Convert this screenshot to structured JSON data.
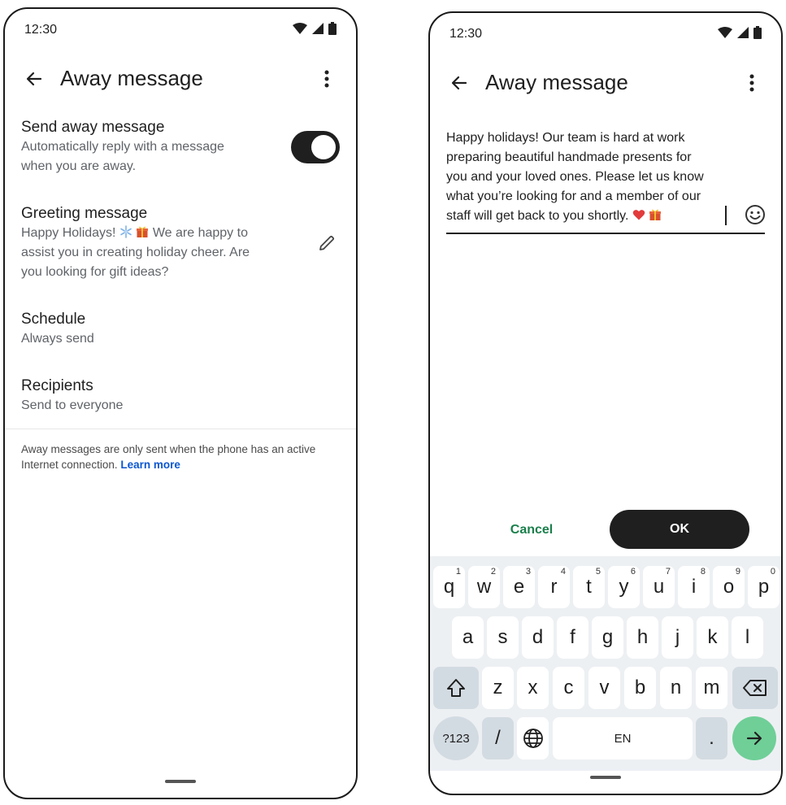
{
  "left": {
    "status_time": "12:30",
    "title": "Away message",
    "send_away": {
      "title": "Send away message",
      "subtitle_line1": "Automatically reply with a message",
      "subtitle_line2": "when you are away.",
      "enabled": true
    },
    "greeting": {
      "title": "Greeting message",
      "line1_a": "Happy Holidays! ",
      "line1_b": " We are happy to",
      "line2": "assist you in creating holiday cheer. Are",
      "line3": "you looking for gift ideas?"
    },
    "schedule": {
      "title": "Schedule",
      "value": "Always send"
    },
    "recipients": {
      "title": "Recipients",
      "value": "Send to everyone"
    },
    "footnote": "Away messages are only sent when the phone has an active Internet connection. ",
    "learn_more": "Learn more"
  },
  "right": {
    "status_time": "12:30",
    "title": "Away message",
    "message_lines": [
      "Happy holidays! Our team is hard at work",
      "preparing beautiful handmade presents for",
      "you and your loved ones. Please let us know",
      "what you’re looking for and a member of our",
      "staff will get back to you shortly. "
    ],
    "cancel_label": "Cancel",
    "ok_label": "OK",
    "keyboard": {
      "row1": [
        {
          "k": "q",
          "h": "1"
        },
        {
          "k": "w",
          "h": "2"
        },
        {
          "k": "e",
          "h": "3"
        },
        {
          "k": "r",
          "h": "4"
        },
        {
          "k": "t",
          "h": "5"
        },
        {
          "k": "y",
          "h": "6"
        },
        {
          "k": "u",
          "h": "7"
        },
        {
          "k": "i",
          "h": "8"
        },
        {
          "k": "o",
          "h": "9"
        },
        {
          "k": "p",
          "h": "0"
        }
      ],
      "row2": [
        "a",
        "s",
        "d",
        "f",
        "g",
        "h",
        "j",
        "k",
        "l"
      ],
      "row3": [
        "z",
        "x",
        "c",
        "v",
        "b",
        "n",
        "m"
      ],
      "symbols_label": "?123",
      "slash_label": "/",
      "space_label": "EN",
      "period_label": "."
    }
  },
  "colors": {
    "accent_green": "#1a7f4b",
    "link_blue": "#0b57d0",
    "toggle_on": "#1f1f1f",
    "enter_key": "#6fcf97"
  }
}
